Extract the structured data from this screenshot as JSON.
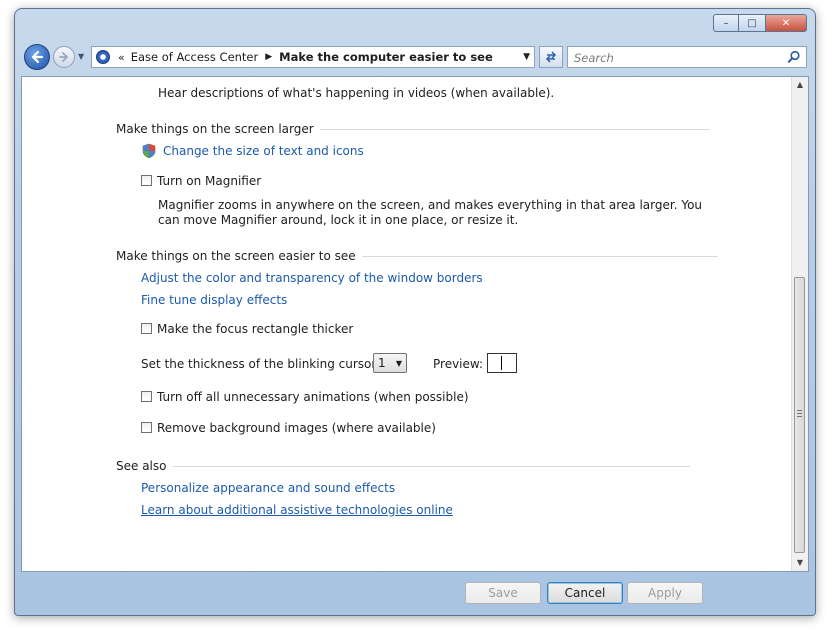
{
  "window": {
    "caption_buttons": {
      "minimize": "–",
      "maximize": "□",
      "close": "✕"
    }
  },
  "nav": {
    "breadcrumb_prefix": "«",
    "breadcrumbs": [
      "Ease of Access Center",
      "Make the computer easier to see"
    ],
    "search_placeholder": "Search"
  },
  "content": {
    "top_description": "Hear descriptions of what's happening in videos (when available).",
    "sections": [
      {
        "heading": "Make things on the screen larger",
        "links": [
          "Change the size of text and icons"
        ],
        "checkboxes": [
          {
            "label": "Turn on Magnifier",
            "checked": false,
            "description": "Magnifier zooms in anywhere on the screen, and makes everything in that area larger. You can move Magnifier around, lock it in one place, or resize it."
          }
        ]
      },
      {
        "heading": "Make things on the screen easier to see",
        "links": [
          "Adjust the color and transparency of the window borders",
          "Fine tune display effects"
        ],
        "focus_checkbox": {
          "label": "Make the focus rectangle thicker",
          "checked": false
        },
        "cursor_thickness": {
          "label": "Set the thickness of the blinking cursor:",
          "value": "1",
          "preview_label": "Preview:"
        },
        "checkboxes": [
          {
            "label": "Turn off all unnecessary animations (when possible)",
            "checked": false
          },
          {
            "label": "Remove background images (where available)",
            "checked": false
          }
        ]
      },
      {
        "heading": "See also",
        "links": [
          "Personalize appearance and sound effects",
          "Learn about additional assistive technologies online"
        ]
      }
    ]
  },
  "footer": {
    "save": "Save",
    "cancel": "Cancel",
    "apply": "Apply"
  },
  "colors": {
    "link": "#1c5aab",
    "frame": "#b6cde6"
  }
}
